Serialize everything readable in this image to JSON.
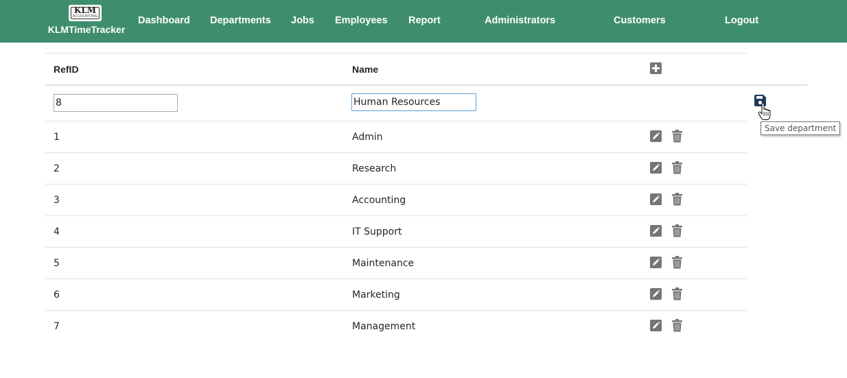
{
  "brand": {
    "logo_text": "KLM",
    "logo_subtext": "ACCOUNTING",
    "name": "KLMTimeTracker"
  },
  "nav": {
    "dashboard": "Dashboard",
    "departments": "Departments",
    "jobs": "Jobs",
    "employees": "Employees",
    "report": "Report",
    "administrators": "Administrators",
    "customers": "Customers",
    "logout": "Logout"
  },
  "table": {
    "headers": {
      "refid": "RefID",
      "name": "Name"
    },
    "new_row": {
      "refid_value": "8",
      "name_value": "Human Resources"
    },
    "rows": [
      {
        "refid": "1",
        "name": "Admin"
      },
      {
        "refid": "2",
        "name": "Research"
      },
      {
        "refid": "3",
        "name": "Accounting"
      },
      {
        "refid": "4",
        "name": "IT Support"
      },
      {
        "refid": "5",
        "name": "Maintenance"
      },
      {
        "refid": "6",
        "name": "Marketing"
      },
      {
        "refid": "7",
        "name": "Management"
      }
    ]
  },
  "tooltip": {
    "save": "Save department"
  },
  "colors": {
    "navbar": "#3e8e6d",
    "icon_gray": "#757575",
    "save_icon": "#1f3a5f"
  },
  "icons": [
    "add-icon",
    "save-icon",
    "edit-icon",
    "trash-icon",
    "hand-cursor-icon"
  ]
}
